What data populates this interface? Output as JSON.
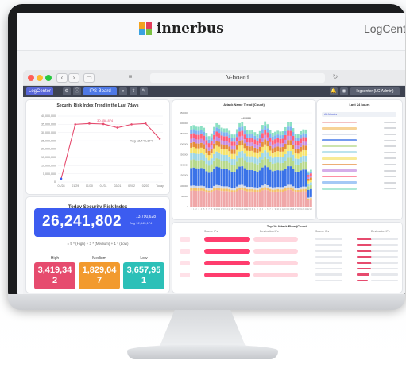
{
  "brand": {
    "logo_text": "innerbus",
    "right_text": "LogCent"
  },
  "browser": {
    "url_text": "V-board"
  },
  "app": {
    "logo_label": "LogCenter",
    "board_label": "IPS Board",
    "user_label": "logcenter (LC Admin)"
  },
  "line_chart": {
    "title": "Security Risk Index Trend in the Last 7days",
    "peak_label": "30,658,874",
    "end_label": "Aug 12,445,174"
  },
  "today": {
    "title": "Today Security Risk Index",
    "value": "26,241,802",
    "compare_top": "13,790,628",
    "compare_bottom": "Aug 12,445,174",
    "formula": "= 5 * (High) + 3 * (Medium) + 1 * (Low)",
    "levels": [
      {
        "label": "High",
        "value": "3,419,34",
        "suffix": "2",
        "color": "#e64b6e"
      },
      {
        "label": "Medium",
        "value": "1,829,04",
        "suffix": "7",
        "color": "#f29a2e"
      },
      {
        "label": "Low",
        "value": "3,657,95",
        "suffix": "1",
        "color": "#2cc0b8"
      }
    ]
  },
  "chart_data": [
    {
      "type": "line",
      "title": "Security Risk Index Trend in the Last 7days",
      "categories": [
        "01/28",
        "01/29",
        "01/30",
        "01/31",
        "02/01",
        "02/02",
        "02/03",
        "Today"
      ],
      "values": [
        2000000,
        35000000,
        35500000,
        35200000,
        33000000,
        35000000,
        35500000,
        26241802
      ],
      "ylim": [
        0,
        40000000
      ],
      "yticks": [
        "40,000,000",
        "35,000,000",
        "30,000,000",
        "25,000,000",
        "20,000,000",
        "15,000,000",
        "10,000,000",
        "5,000,000",
        "0"
      ],
      "grid": true
    },
    {
      "type": "bar",
      "title": "Attack Name Trend (Count)",
      "stacked": true,
      "bar_count": 48,
      "ylim": [
        0,
        450000
      ],
      "yticks": [
        "450,000",
        "400,000",
        "350,000",
        "300,000",
        "250,000",
        "200,000",
        "150,000",
        "100,000",
        "50,000",
        "0"
      ],
      "series_colors": [
        "#f0a7a8",
        "#f4c16b",
        "#cfd6e6",
        "#3a72e8",
        "#b7d98b",
        "#9fd7e6",
        "#f6e36b",
        "#e68c3a",
        "#c58be0",
        "#ff5f7a",
        "#7fb2f2",
        "#8be0c4"
      ],
      "highlight_label": "440,888"
    }
  ],
  "top_attacks": {
    "title": "Last 24 hours",
    "header_tag": "All Attacks"
  },
  "top_flows": {
    "title": "Top 10 Attack Flow (Count)",
    "col_source": "Source IPs",
    "col_dest": "Destination IPs"
  }
}
